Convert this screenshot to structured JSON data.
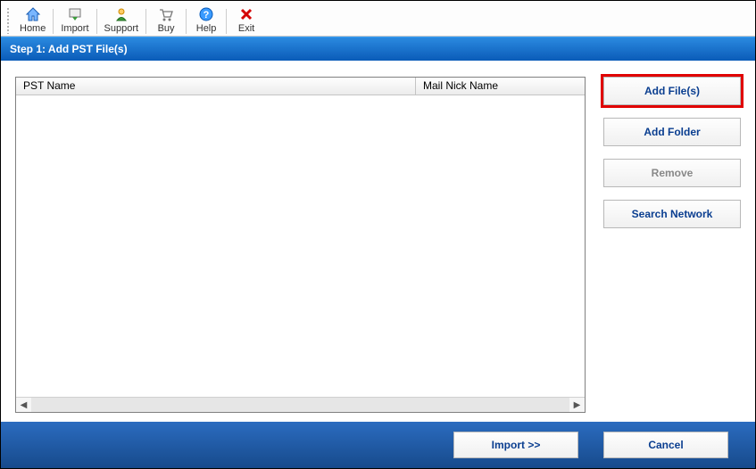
{
  "toolbar": {
    "items": [
      {
        "label": "Home"
      },
      {
        "label": "Import"
      },
      {
        "label": "Support"
      },
      {
        "label": "Buy"
      },
      {
        "label": "Help"
      },
      {
        "label": "Exit"
      }
    ]
  },
  "step": {
    "title": "Step 1: Add PST File(s)"
  },
  "table": {
    "columns": {
      "pst_name": "PST Name",
      "mail_nick": "Mail Nick Name"
    },
    "rows": []
  },
  "side_buttons": {
    "add_files": "Add File(s)",
    "add_folder": "Add Folder",
    "remove": "Remove",
    "search_network": "Search Network"
  },
  "footer": {
    "import": "Import >>",
    "cancel": "Cancel"
  }
}
